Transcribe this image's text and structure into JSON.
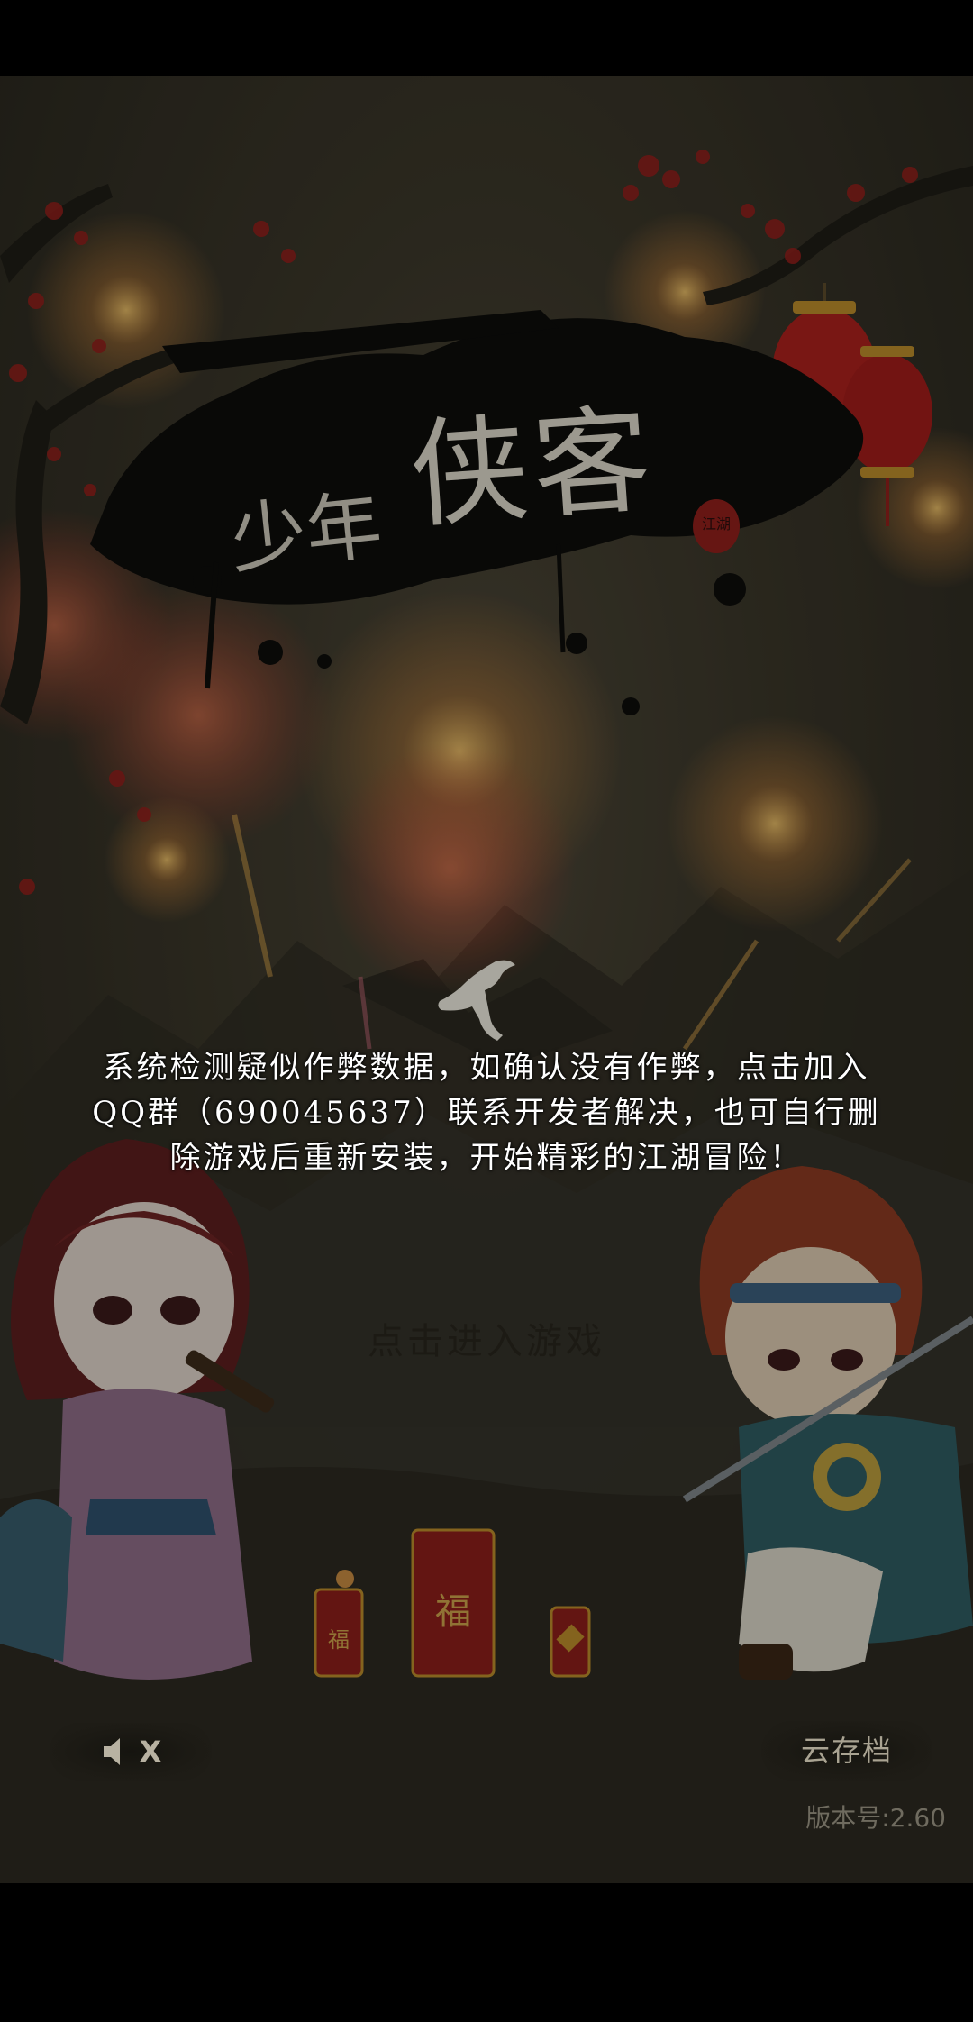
{
  "game": {
    "title_small": "少年",
    "title_large": "侠客",
    "seal_text": "江湖",
    "notice_lines": [
      "系统检测疑似作弊数据，如确认没有作弊，点击加入",
      "QQ群（690045637）联系开发者解决，也可自行删",
      "除游戏后重新安装，开始精彩的江湖冒险！"
    ],
    "enter_label": "点击进入游戏",
    "sound_toggle_label": "X",
    "cloud_save_label": "云存档",
    "version_label": "版本号:2.60",
    "firecracker_glyph": "福"
  },
  "colors": {
    "background": "#3a3629",
    "lantern": "#b3211e",
    "blossom": "#9c1f1c",
    "firework": "#e8b14a",
    "ink": "#0b0b0a"
  }
}
